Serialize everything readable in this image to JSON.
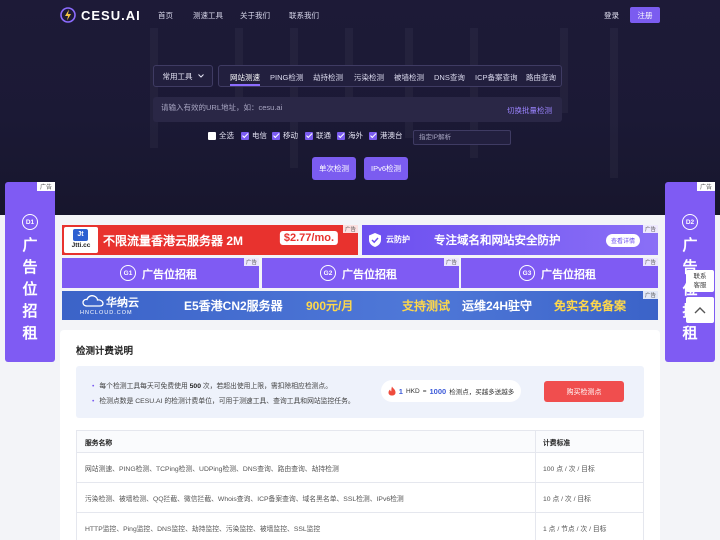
{
  "nav": {
    "logo_text": "CESU.AI",
    "links": [
      "首页",
      "测速工具",
      "关于我们",
      "联系我们"
    ],
    "login": "登录",
    "register": "注册"
  },
  "tool": {
    "select_label": "常用工具",
    "tabs": [
      "网站测速",
      "PING检测",
      "劫持检测",
      "污染检测",
      "被墙检测",
      "DNS查询",
      "ICP备案查询",
      "路由查询"
    ],
    "active_tab": "网站测速",
    "url_placeholder": "请输入有效的URL地址，如：cesu.ai",
    "batch_link": "切换批量检测",
    "checkboxes": [
      {
        "label": "全选",
        "checked": false
      },
      {
        "label": "电信",
        "checked": true
      },
      {
        "label": "移动",
        "checked": true
      },
      {
        "label": "联通",
        "checked": true
      },
      {
        "label": "海外",
        "checked": true
      },
      {
        "label": "港澳台",
        "checked": true
      }
    ],
    "ip_placeholder": "指定IP解析",
    "btn_single": "单次检测",
    "btn_ipv6": "IPv6检测"
  },
  "side_ads": {
    "left": {
      "tag": "广告",
      "badge": "D1",
      "chars": [
        "广",
        "告",
        "位",
        "招",
        "租"
      ]
    },
    "right": {
      "tag": "广告",
      "badge": "D2",
      "chars": [
        "广",
        "告",
        "位",
        "招",
        "租"
      ]
    }
  },
  "ads": {
    "tag": "广告",
    "jtti": {
      "logo_top": "Jt",
      "logo_bottom": "Jtti.cc",
      "text": "不限流量香港云服务器 2M",
      "price": "$2.77/mo."
    },
    "yunhu": {
      "brand": "云防护",
      "text": "专注域名和网站安全防护",
      "button": "查看详情"
    },
    "g_slots": [
      {
        "badge": "G1",
        "text": "广告位招租"
      },
      {
        "badge": "G2",
        "text": "广告位招租"
      },
      {
        "badge": "G3",
        "text": "广告位招租"
      }
    ],
    "hncloud": {
      "brand_cn": "华纳云",
      "brand_en": "HNCLOUD.COM",
      "offer": "E5香港CN2服务器",
      "price": "900元/月",
      "support_a": "支持测试",
      "support_b": "运维24H驻守",
      "support_c": "免实名免备案"
    }
  },
  "billing": {
    "title": "检测计费说明",
    "bullet1_pre": "每个检测工具每天可免费使用 ",
    "bullet1_num": "500",
    "bullet1_post": " 次，若超出使用上限，需扣除相应检测点。",
    "bullet2": "检测点数是 CESU.AI 的检测计费单位，可用于测速工具、查询工具和网站监控任务。",
    "rate_a": "1",
    "rate_b": "HKD",
    "rate_c": "=",
    "rate_d": "1000",
    "rate_e": "检测点，买越多送越多",
    "buy_button": "购买检测点",
    "table": {
      "headers": [
        "服务名称",
        "计费标准"
      ],
      "rows": [
        [
          "网站测速、PING检测、TCPing检测、UDPing检测、DNS查询、路由查询、劫持检测",
          "100 点 / 次 / 目标"
        ],
        [
          "污染检测、被墙检测、QQ拦截、微信拦截、Whois查询、ICP备案查询、域名黑名单、SSL检测、IPv6检测",
          "10 点 / 次 / 目标"
        ],
        [
          "HTTP监控、Ping监控、DNS监控、劫持监控、污染监控、被墙监控、SSL监控",
          "1 点 / 节点 / 次 / 目标"
        ]
      ]
    }
  },
  "float": {
    "service_a": "联系",
    "service_b": "客服"
  },
  "colors": {
    "hero_bg": "#1d1a37",
    "accent": "#7b5cf0",
    "buy_red": "#f04e4e",
    "jtti_red": "#e8322e",
    "hn_blue": "#3b63c8"
  }
}
